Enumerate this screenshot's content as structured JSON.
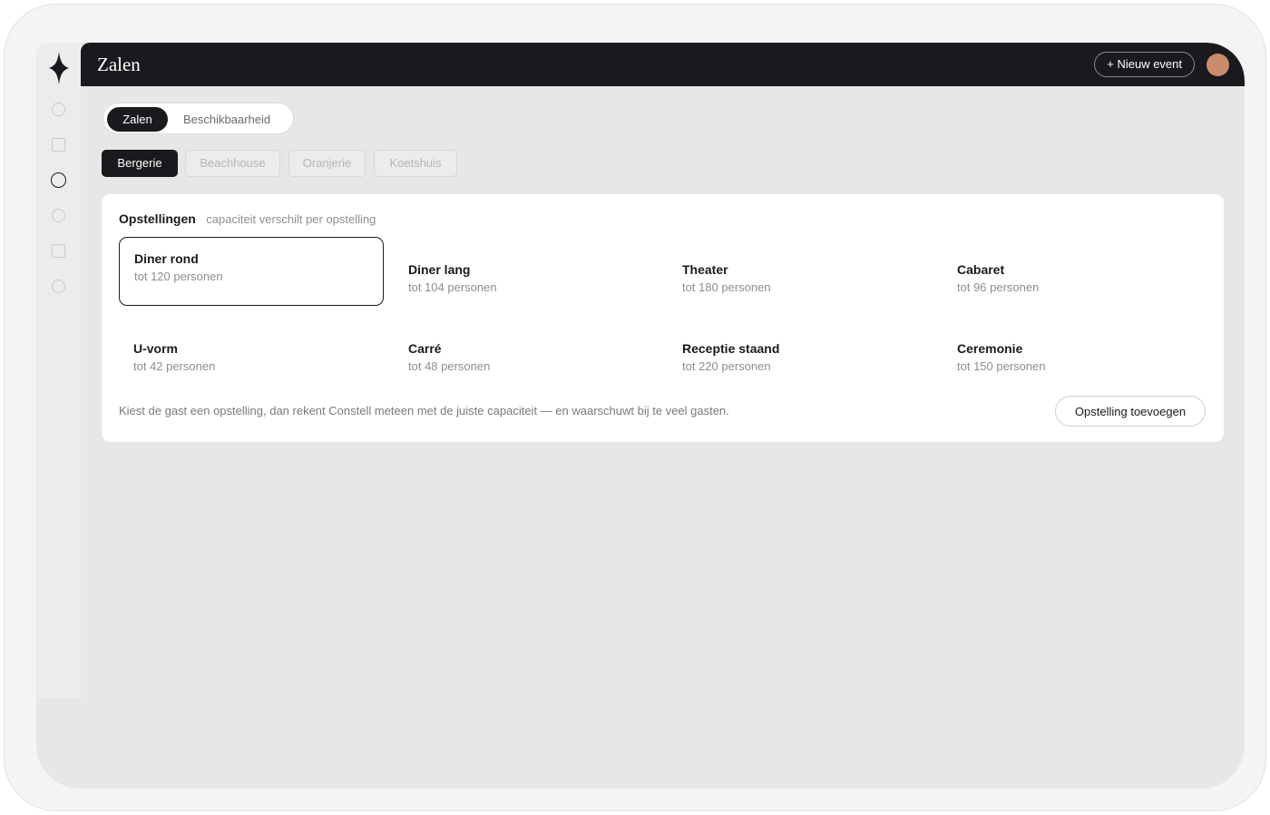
{
  "header": {
    "title": "Zalen",
    "new_event_label": "+ Nieuw event"
  },
  "sidebar": {
    "logo_icon": "four-point-star-icon",
    "items": [
      {
        "icon": "circle-icon",
        "active": false
      },
      {
        "icon": "square-icon",
        "active": false
      },
      {
        "icon": "circle-icon",
        "active": true
      },
      {
        "icon": "circle-icon",
        "active": false
      },
      {
        "icon": "square-icon",
        "active": false
      },
      {
        "icon": "circle-icon",
        "active": false
      }
    ]
  },
  "tabs": [
    {
      "label": "Zalen",
      "active": true
    },
    {
      "label": "Beschikbaarheid",
      "active": false
    }
  ],
  "venues": [
    {
      "label": "Bergerie",
      "active": true
    },
    {
      "label": "Beachhouse",
      "active": false
    },
    {
      "label": "Oranjerie",
      "active": false
    },
    {
      "label": "Koetshuis",
      "active": false
    }
  ],
  "setups_card": {
    "title": "Opstellingen",
    "subtitle": "capaciteit verschilt per opstelling",
    "setups": [
      {
        "name": "Diner rond",
        "capacity": "tot 120 personen",
        "selected": true
      },
      {
        "name": "Diner lang",
        "capacity": "tot 104 personen",
        "selected": false
      },
      {
        "name": "Theater",
        "capacity": "tot 180 personen",
        "selected": false
      },
      {
        "name": "Cabaret",
        "capacity": "tot 96 personen",
        "selected": false
      },
      {
        "name": "U-vorm",
        "capacity": "tot 42 personen",
        "selected": false
      },
      {
        "name": "Carré",
        "capacity": "tot 48 personen",
        "selected": false
      },
      {
        "name": "Receptie staand",
        "capacity": "tot 220 personen",
        "selected": false
      },
      {
        "name": "Ceremonie",
        "capacity": "tot 150 personen",
        "selected": false
      }
    ],
    "footnote": "Kiest de gast een opstelling, dan rekent Constell meteen met de juiste capaciteit — en waarschuwt bij te veel gasten.",
    "add_button_label": "Opstelling toevoegen"
  },
  "colors": {
    "dark": "#1a1a1e",
    "avatar": "#c98c6c",
    "canvas": "#e7e7e7"
  }
}
